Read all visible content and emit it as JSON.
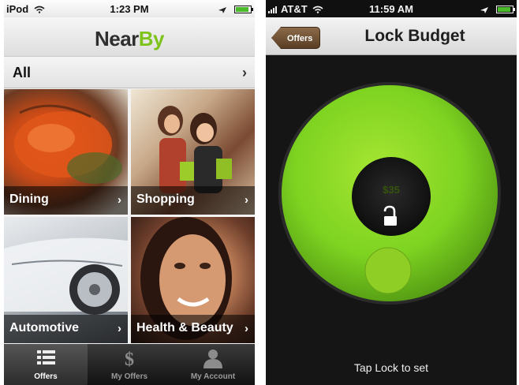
{
  "left_screen": {
    "status": {
      "carrier": "iPod",
      "time": "1:23 PM"
    },
    "brand": {
      "part1": "Near",
      "part2": "By",
      "accent": "#7ec21c"
    },
    "all_row": {
      "label": "All",
      "chevron": "›"
    },
    "categories": [
      {
        "label": "Dining",
        "chevron": "›"
      },
      {
        "label": "Shopping",
        "chevron": "›"
      },
      {
        "label": "Automotive",
        "chevron": "›"
      },
      {
        "label": "Health & Beauty",
        "chevron": "›"
      }
    ],
    "tabs": [
      {
        "label": "Offers",
        "icon": "list-icon",
        "selected": true
      },
      {
        "label": "My Offers",
        "icon": "dollar-icon",
        "selected": false
      },
      {
        "label": "My Account",
        "icon": "person-icon",
        "selected": false
      }
    ]
  },
  "right_screen": {
    "status": {
      "carrier": "AT&T",
      "time": "11:59 AM"
    },
    "back_label": "Offers",
    "title": "Lock Budget",
    "budget_amount": "$35",
    "lock_icon": "unlock-icon",
    "hint": "Tap Lock to set",
    "dial_color": "#7ed321"
  }
}
